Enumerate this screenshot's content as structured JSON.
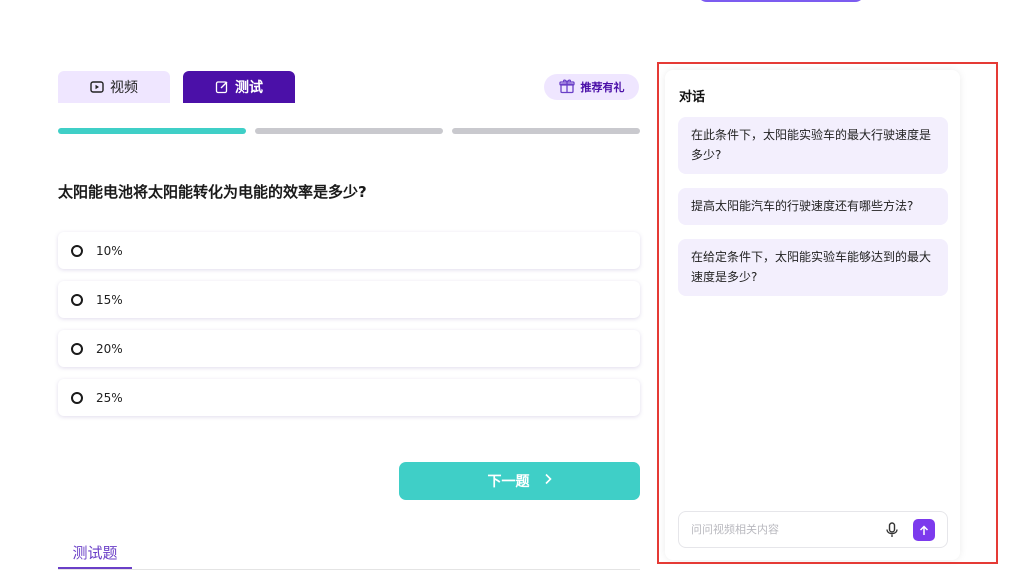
{
  "tabs": {
    "video_label": "视频",
    "test_label": "测试"
  },
  "gift_label": "推荐有礼",
  "question": "太阳能电池将太阳能转化为电能的效率是多少?",
  "options": [
    "10%",
    "15%",
    "20%",
    "25%"
  ],
  "next_label": "下一题",
  "bottom_tab_label": "测试题",
  "chat": {
    "title": "对话",
    "suggestions": [
      "在此条件下，太阳能实验车的最大行驶速度是多少?",
      "提高太阳能汽车的行驶速度还有哪些方法?",
      "在给定条件下，太阳能实验车能够达到的最大速度是多少?"
    ],
    "input_placeholder": "问问视频相关内容"
  },
  "colors": {
    "accent_purple": "#4b10a8",
    "teal": "#3fcfc7",
    "send_purple": "#7c3aed",
    "highlight_red": "#e53a35"
  },
  "icons": [
    "play-icon",
    "edit-icon",
    "gift-icon",
    "chevron-right-icon",
    "mic-icon",
    "arrow-up-icon"
  ]
}
